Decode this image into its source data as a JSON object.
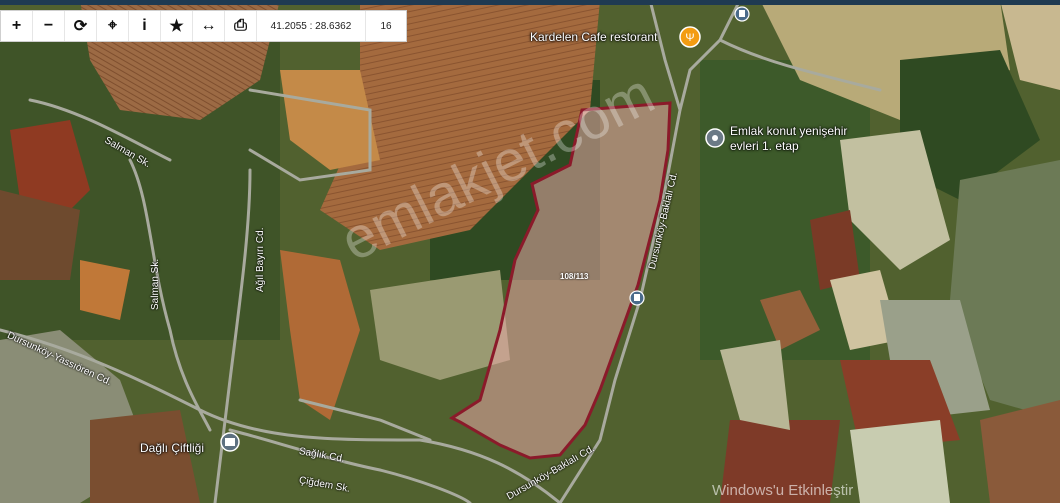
{
  "toolbar": {
    "buttons": [
      {
        "glyph": "+",
        "icon": "zoom-in-icon"
      },
      {
        "glyph": "−",
        "icon": "zoom-out-icon"
      },
      {
        "glyph": "⟳",
        "icon": "refresh-icon"
      },
      {
        "glyph": "⌖",
        "icon": "crosshair-icon"
      },
      {
        "glyph": "i",
        "icon": "info-icon"
      },
      {
        "glyph": "★",
        "icon": "star-icon"
      },
      {
        "glyph": "↔",
        "icon": "measure-icon"
      },
      {
        "glyph": "⎙",
        "icon": "print-icon"
      }
    ],
    "coordinates": "41.2055 : 28.6362",
    "zoom": "16"
  },
  "places": {
    "cafe": "Kardelen Cafe restorant",
    "emlak_line1": "Emlak konut yenişehir",
    "emlak_line2": "evleri 1. etap",
    "dagli": "Dağlı Çiftliği"
  },
  "streets": {
    "salman1": "Salman Sk.",
    "salman2": "Salman Sk.",
    "agil": "Ağıl Bayırı Cd.",
    "yassioren": "Dursunköy-Yassıören Cd.",
    "bakla_north": "Dursunköy-Baklalı Cd.",
    "bakla_south": "Dursunköy-Baklalı Cd.",
    "saglik": "Sağlık Cd.",
    "cigdem": "Çiğdem Sk."
  },
  "parcel": {
    "id": "108/113",
    "outline_color": "#8b1a2a",
    "fill_color": "#e8a9a6"
  },
  "watermark": "emlakjet.com",
  "windows_mark": "Windows'u Etkinleştir",
  "colors": {
    "accent_orange": "#f39c12",
    "marker_gray": "#6b7a86",
    "bus_blue": "#4a6a8a"
  }
}
